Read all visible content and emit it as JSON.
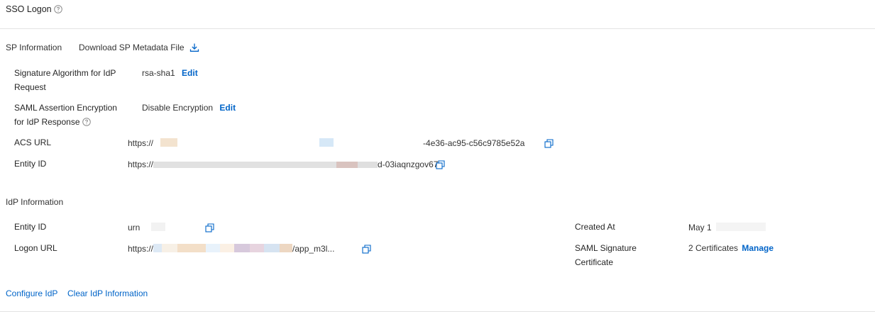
{
  "header": {
    "title": "SSO Logon"
  },
  "sp": {
    "section_label": "SP Information",
    "download_label": "Download SP Metadata File",
    "signature_algorithm": {
      "label": "Signature Algorithm for IdP Request",
      "value": "rsa-sha1",
      "action": "Edit"
    },
    "assertion_encryption": {
      "label": "SAML Assertion Encryption for IdP Response",
      "value": "Disable Encryption",
      "action": "Edit"
    },
    "acs_url": {
      "label": "ACS URL",
      "value_prefix": "https://",
      "value_suffix": "-4e36-ac95-c56c9785e52a"
    },
    "entity_id": {
      "label": "Entity ID",
      "value_prefix": "https://",
      "value_suffix": "d-03iaqnzgov67"
    }
  },
  "idp": {
    "section_label": "IdP Information",
    "entity_id": {
      "label": "Entity ID",
      "value_prefix": "urn"
    },
    "logon_url": {
      "label": "Logon URL",
      "value_prefix": "https://",
      "value_suffix": "/app_m3l..."
    },
    "created_at": {
      "label": "Created At",
      "value_prefix": "May 1"
    },
    "saml_certificate": {
      "label": "SAML Signature Certificate",
      "value": "2 Certificates",
      "action": "Manage"
    }
  },
  "footer": {
    "configure_label": "Configure IdP",
    "clear_label": "Clear IdP Information"
  },
  "colors": {
    "link": "#0064c8",
    "divider": "#e3e3e3",
    "text": "#333333"
  },
  "icons": {
    "help": "question-circle-icon",
    "download": "download-icon",
    "copy": "copy-icon"
  }
}
